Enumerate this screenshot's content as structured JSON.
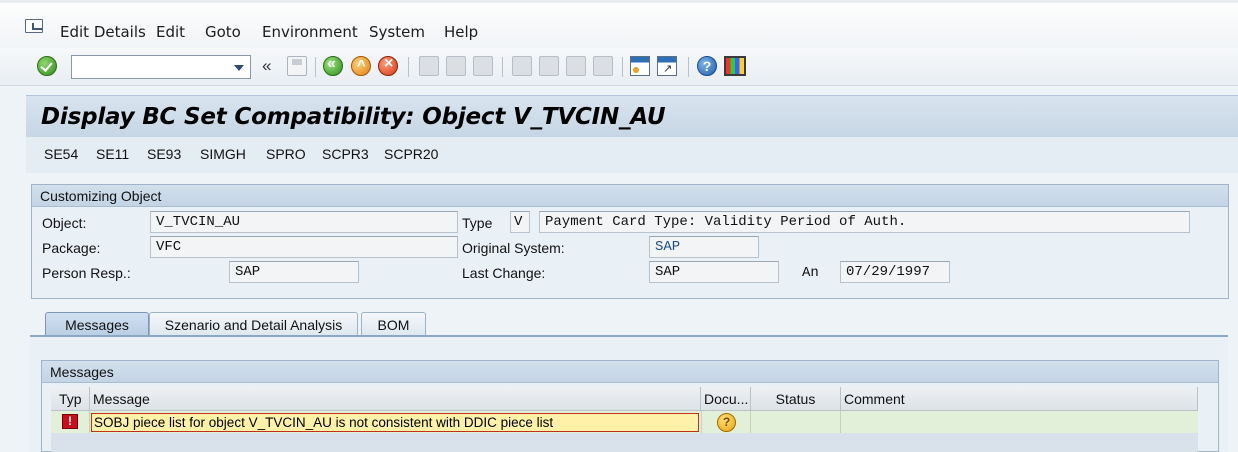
{
  "menubar": {
    "items": [
      "Edit Details",
      "Edit",
      "Goto",
      "Environment",
      "System",
      "Help"
    ]
  },
  "toolbar": {
    "command_field_value": "",
    "collapse_glyph": "«",
    "help_glyph": "?"
  },
  "title": "Display BC Set Compatibility: Object V_TVCIN_AU",
  "app_toolbar": [
    "SE54",
    "SE11",
    "SE93",
    "SIMGH",
    "SPRO",
    "SCPR3",
    "SCPR20"
  ],
  "customizing": {
    "group_title": "Customizing Object",
    "object_label": "Object:",
    "object_value": "V_TVCIN_AU",
    "type_label": "Type",
    "type_value": "V",
    "type_desc": "Payment Card Type: Validity Period of Auth.",
    "package_label": "Package:",
    "package_value": "VFC",
    "orig_system_label": "Original System:",
    "orig_system_value": "SAP",
    "person_label": "Person Resp.:",
    "person_value": "SAP",
    "last_change_label": "Last Change:",
    "last_change_value": "SAP",
    "on_label": "An",
    "on_value": "07/29/1997"
  },
  "tabs": [
    "Messages",
    "Szenario and Detail Analysis",
    "BOM"
  ],
  "messages": {
    "group_title": "Messages",
    "columns": [
      "Typ",
      "Message",
      "Docu...",
      "Status",
      "Comment"
    ],
    "rows": [
      {
        "type": "error",
        "type_glyph": "!",
        "message": "SOBJ piece list for object V_TVCIN_AU is not consistent with DDIC piece list",
        "docu_glyph": "?",
        "status": "",
        "comment": ""
      }
    ]
  },
  "colors": {
    "title_bg": "#c7d6e5",
    "error_red": "#c8101a",
    "row_highlight": "#fff2a8",
    "row_green": "#e2f0d9"
  }
}
